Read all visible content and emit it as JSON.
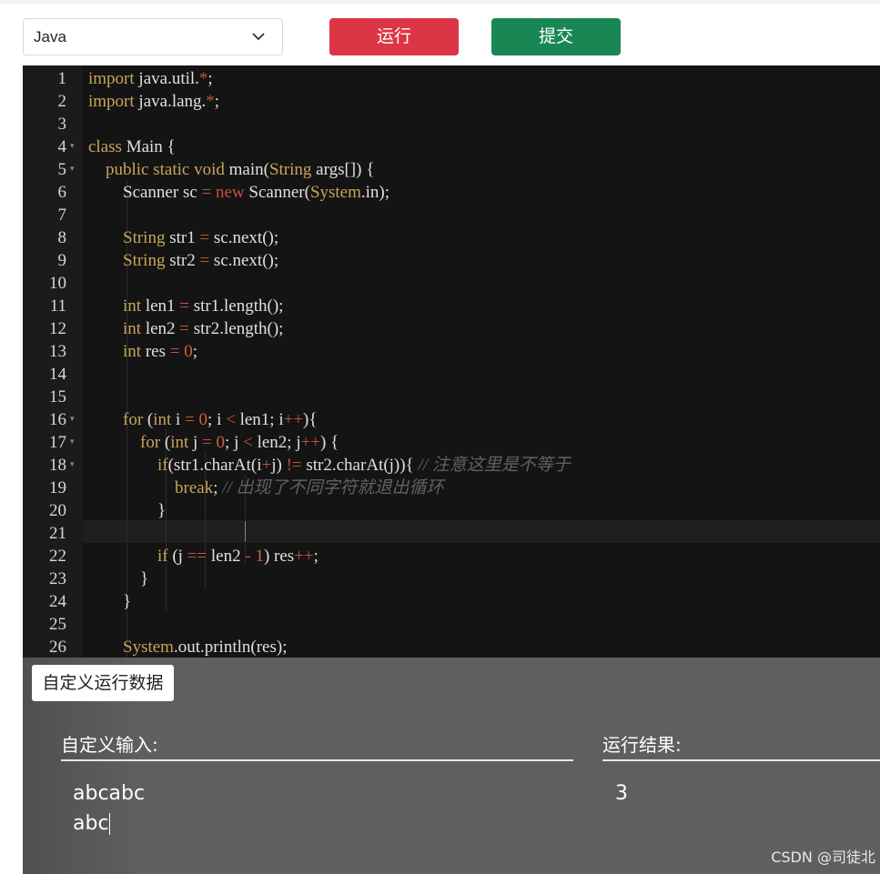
{
  "toolbar": {
    "language": "Java",
    "run_label": "运行",
    "submit_label": "提交"
  },
  "editor": {
    "line_numbers": [
      "1",
      "2",
      "3",
      "4",
      "5",
      "6",
      "7",
      "8",
      "9",
      "10",
      "11",
      "12",
      "13",
      "14",
      "15",
      "16",
      "17",
      "18",
      "19",
      "20",
      "21",
      "22",
      "23",
      "24",
      "25",
      "26"
    ]
  },
  "panel": {
    "custom_button": "自定义运行数据",
    "input_title": "自定义输入:",
    "output_title": "运行结果:",
    "input_line1": "abcabc",
    "input_line2": "abc",
    "output_value": "3"
  },
  "watermark": "CSDN @司徒北"
}
